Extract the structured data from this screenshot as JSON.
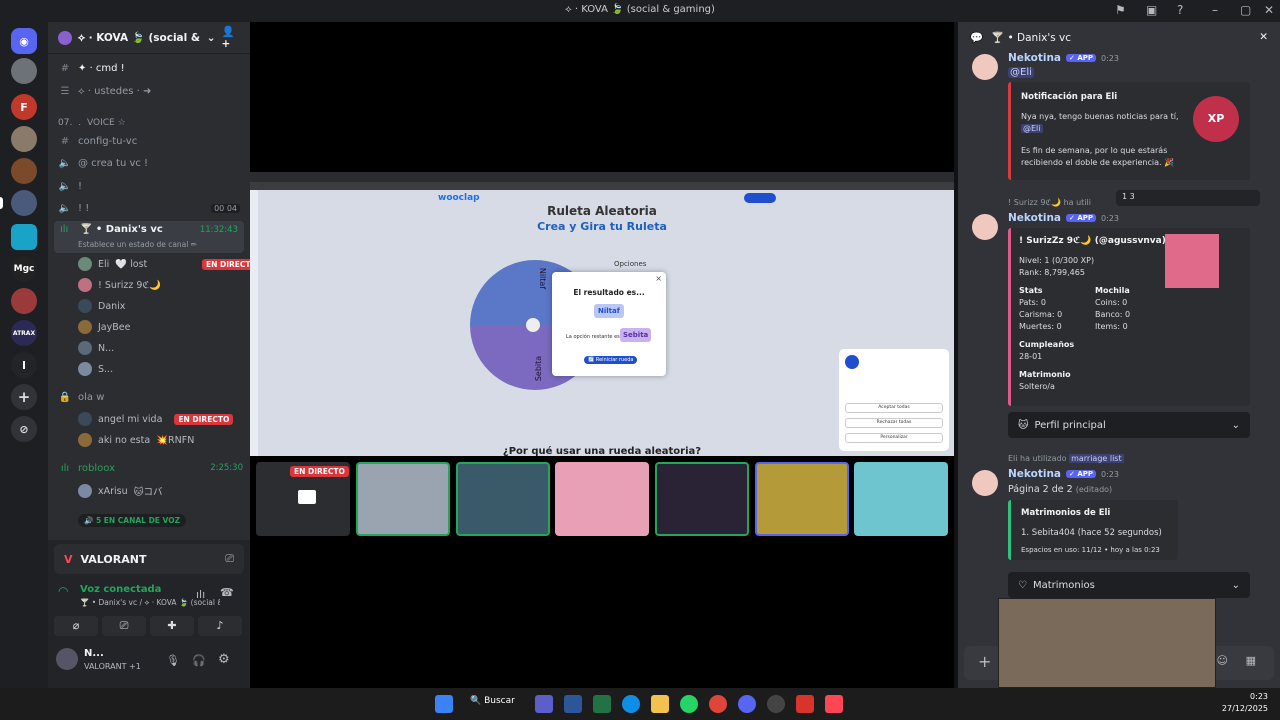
{
  "window": {
    "title": "⟡ · KOVA 🍃 (social & gaming)"
  },
  "server": {
    "name": "⟡ · KOVA 🍃 (social & g..."
  },
  "channels": {
    "cmd": "✦ · cmd !",
    "ustedes": "⟡ · ustedes · ➜",
    "category": "07.  ﹒ VOICE ☆",
    "config": "config-tu-vc",
    "crea": "@ crea tu vc !",
    "ch1": "!",
    "ch2": "! !",
    "ch2_count_a": "00",
    "ch2_count_b": "04",
    "danix_vc": "🍸 • Danix's vc",
    "danix_vc_time": "11:32:43",
    "status_placeholder": "Establece un estado de canal ✏",
    "ola": "ola w",
    "robloox": "robloox",
    "robloox_time": "2:25:30"
  },
  "voice_users": [
    {
      "name": "Eli",
      "tag": "🤍 lost",
      "live": true
    },
    {
      "name": "! Surizz 9ℭ🌙",
      "tag": "",
      "live": false
    },
    {
      "name": "Danix",
      "tag": "",
      "live": false
    },
    {
      "name": "JayBee",
      "tag": "",
      "live": false
    },
    {
      "name": "N...",
      "tag": "",
      "live": false
    },
    {
      "name": "S...",
      "tag": "",
      "live": false
    }
  ],
  "ola_users": [
    {
      "name": "angel mi vida",
      "tag": "",
      "live": true
    },
    {
      "name": "aki no esta",
      "tag": "💥RNFN",
      "live": false
    }
  ],
  "robloox_users": [
    {
      "name": "xArisu",
      "tag": "🐱コバ"
    }
  ],
  "live_label": "EN DIRECTO",
  "voice_popup": "5 EN CANAL DE VOZ",
  "activity": {
    "game": "VALORANT"
  },
  "voice_conn": {
    "status": "Voz conectada",
    "location": "🍸 • Danix's vc / ⟡ · KOVA 🍃 (social & ..."
  },
  "user": {
    "name": "N...",
    "status": "VALORANT +1"
  },
  "stream": {
    "brand": "wooclap",
    "heading1": "Ruleta Aleatoria",
    "heading2": "Crea y Gira tu Ruleta",
    "slice1": "Niltaf",
    "slice2": "Sebita",
    "modal_title": "El resultado es...",
    "modal_result": "Niltaf",
    "modal_remaining_label": "La opción restante es",
    "modal_remaining": "Sebita",
    "modal_button": "🔄 Reiniciar rueda",
    "options_label": "Opciones",
    "bottom_text": "¿Por qué usar una rueda aleatoria?",
    "cookie_btn1": "Aceptar todas",
    "cookie_btn2": "Rechazar todas",
    "cookie_btn3": "Personalizar"
  },
  "chat": {
    "header": "🍸 • Danix's vc",
    "bot_name": "Nekotina",
    "app_label": "✓ APP",
    "m1_time": "0:23",
    "m1_mention": "@Eli",
    "notif_title": "Notificación para Eli",
    "notif_line1": "Nya nya, tengo buenas noticias para tí,",
    "notif_mention": "@Eli",
    "notif_line2": "Es fin de semana, por lo que estarás",
    "notif_line3": "recibiendo el doble de experiencia. 🎉",
    "reply_line": "! Surizz 9ℭ🌙 ha utili",
    "reactions": "1   3",
    "m2_time": "0:23",
    "profile_title": "! SurizZz 9ℭ🌙 (@agussvnva)",
    "nivel": "Nivel: 1 (0/300 XP)",
    "rank": "Rank: 8,799,465",
    "stats_label": "Stats",
    "mochila_label": "Mochila",
    "pats": "Pats: 0",
    "carisma": "Carisma: 0",
    "muertes": "Muertes: 0",
    "coins": "Coins: 0",
    "banco": "Banco: 0",
    "items": "Items: 0",
    "cumple_label": "Cumpleaños",
    "cumple": "28-01",
    "matrimonio_label": "Matrimonio",
    "matrimonio": "Soltero/a",
    "select1": "Perfil principal",
    "used_line": "Eli ha utilizado",
    "used_cmd": "marriage list",
    "m3_time": "0:23",
    "page": "Página 2 de 2",
    "edited": "(editado)",
    "marr_title": "Matrimonios de Eli",
    "marr_entry": "1. Sebita404 (hace 52 segundos)",
    "marr_space": "Espacios en uso: 11/12 • hoy a las 0:23",
    "select2": "Matrimonios"
  },
  "taskbar": {
    "search": "Buscar",
    "time": "0:23",
    "date": "27/12/2025"
  }
}
